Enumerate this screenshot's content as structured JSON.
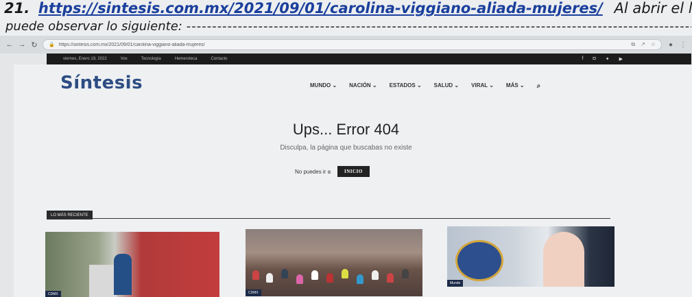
{
  "document": {
    "number": "21.",
    "link": "https://sintesis.com.mx/2021/09/01/carolina-viggiano-aliada-mujeres/",
    "text_after": "Al abrir el link, se",
    "line2": "puede observar lo siguiente:",
    "line2_dashes": "------------------------------------------------------------------------------------------------------"
  },
  "browser": {
    "url": "https://sintesis.com.mx/2021/09/01/carolina-viggiano-aliada-mujeres/"
  },
  "topstrip": {
    "date": "viernes, Enero 19, 2022",
    "links": [
      "Vox",
      "Tecnología",
      "Hemeroteca",
      "Contacto"
    ]
  },
  "site": {
    "logo": "Síntesis",
    "menu": [
      "MUNDO ⌄",
      "NACIÓN ⌄",
      "ESTADOS ⌄",
      "SALUD ⌄",
      "VIRAL ⌄",
      "MÁS ⌄"
    ]
  },
  "error": {
    "title": "Ups... Error 404",
    "subtitle": "Disculpa, la página que buscabas no existe",
    "prompt": "No puedes ir a",
    "button": "INICIO"
  },
  "recent": {
    "label": "LO MÁS RECIENTE",
    "cards": [
      {
        "category": "CDMX"
      },
      {
        "category": "CDMX"
      },
      {
        "category": "Mundo"
      }
    ]
  },
  "colors": {
    "logo": "#2d4c82",
    "link": "#1a3f9c",
    "dark_strip": "#1c1c1c"
  }
}
